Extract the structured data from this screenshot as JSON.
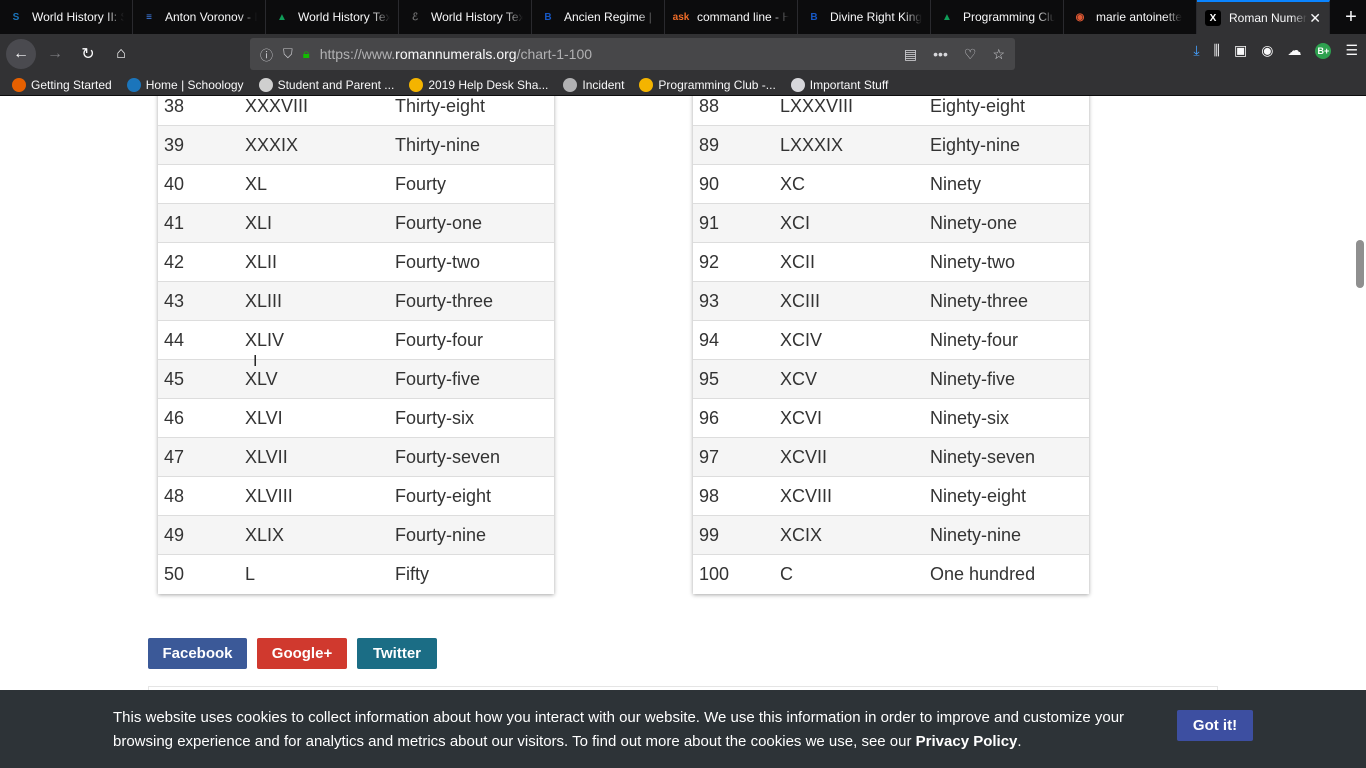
{
  "tabs": [
    {
      "label": "World History II: S",
      "icon": "S",
      "color": "#1b75bb",
      "active": false
    },
    {
      "label": "Anton Voronov - I",
      "icon": "≡",
      "color": "#4285f4",
      "active": false
    },
    {
      "label": "World History Tex",
      "icon": "▲",
      "color": "#0f9d58",
      "active": false
    },
    {
      "label": "World History Tex",
      "icon": "ℰ",
      "color": "#6f6f6f",
      "active": false
    },
    {
      "label": "Ancien Regime | E",
      "icon": "B",
      "color": "#1657c4",
      "active": false
    },
    {
      "label": "command line - H",
      "icon": "ask",
      "color": "#ef6c28",
      "active": false
    },
    {
      "label": "Divine Right King",
      "icon": "B",
      "color": "#1657c4",
      "active": false
    },
    {
      "label": "Programming Clu",
      "icon": "▲",
      "color": "#0f9d58",
      "active": false
    },
    {
      "label": "marie antoinette",
      "icon": "◉",
      "color": "#de5833",
      "active": false
    },
    {
      "label": "Roman Numer",
      "icon": "X",
      "color": "#ffffff",
      "active": true
    }
  ],
  "nav": {
    "url_prefix": "https://www.",
    "url_host": "romannumerals.org",
    "url_path": "/chart-1-100"
  },
  "bookmarks": [
    {
      "label": "Getting Started",
      "icon": "firefox-icon",
      "color": "#e66000"
    },
    {
      "label": "Home | Schoology",
      "icon": "schoology-icon",
      "color": "#1b75bb"
    },
    {
      "label": "Student and Parent ...",
      "icon": "p-icon",
      "color": "#cfcfcf"
    },
    {
      "label": "2019 Help Desk Sha...",
      "icon": "drive-icon",
      "color": "#f4b400"
    },
    {
      "label": "Incident",
      "icon": "globe-icon",
      "color": "#b1b1b3"
    },
    {
      "label": "Programming Club -...",
      "icon": "drive-icon",
      "color": "#f4b400"
    },
    {
      "label": "Important Stuff",
      "icon": "folder-icon",
      "color": "#d7d7db"
    }
  ],
  "left_table": [
    {
      "num": "38",
      "roman": "XXXVIII",
      "word": "Thirty-eight"
    },
    {
      "num": "39",
      "roman": "XXXIX",
      "word": "Thirty-nine"
    },
    {
      "num": "40",
      "roman": "XL",
      "word": "Fourty"
    },
    {
      "num": "41",
      "roman": "XLI",
      "word": "Fourty-one"
    },
    {
      "num": "42",
      "roman": "XLII",
      "word": "Fourty-two"
    },
    {
      "num": "43",
      "roman": "XLIII",
      "word": "Fourty-three"
    },
    {
      "num": "44",
      "roman": "XLIV",
      "word": "Fourty-four"
    },
    {
      "num": "45",
      "roman": "XLV",
      "word": "Fourty-five"
    },
    {
      "num": "46",
      "roman": "XLVI",
      "word": "Fourty-six"
    },
    {
      "num": "47",
      "roman": "XLVII",
      "word": "Fourty-seven"
    },
    {
      "num": "48",
      "roman": "XLVIII",
      "word": "Fourty-eight"
    },
    {
      "num": "49",
      "roman": "XLIX",
      "word": "Fourty-nine"
    },
    {
      "num": "50",
      "roman": "L",
      "word": "Fifty"
    }
  ],
  "right_table": [
    {
      "num": "88",
      "roman": "LXXXVIII",
      "word": "Eighty-eight"
    },
    {
      "num": "89",
      "roman": "LXXXIX",
      "word": "Eighty-nine"
    },
    {
      "num": "90",
      "roman": "XC",
      "word": "Ninety"
    },
    {
      "num": "91",
      "roman": "XCI",
      "word": "Ninety-one"
    },
    {
      "num": "92",
      "roman": "XCII",
      "word": "Ninety-two"
    },
    {
      "num": "93",
      "roman": "XCIII",
      "word": "Ninety-three"
    },
    {
      "num": "94",
      "roman": "XCIV",
      "word": "Ninety-four"
    },
    {
      "num": "95",
      "roman": "XCV",
      "word": "Ninety-five"
    },
    {
      "num": "96",
      "roman": "XCVI",
      "word": "Ninety-six"
    },
    {
      "num": "97",
      "roman": "XCVII",
      "word": "Ninety-seven"
    },
    {
      "num": "98",
      "roman": "XCVIII",
      "word": "Ninety-eight"
    },
    {
      "num": "99",
      "roman": "XCIX",
      "word": "Ninety-nine"
    },
    {
      "num": "100",
      "roman": "C",
      "word": "One hundred"
    }
  ],
  "share": {
    "facebook": "Facebook",
    "google": "Google+",
    "twitter": "Twitter"
  },
  "cookie": {
    "text": "This website uses cookies to collect information about how you interact with our website. We use this information in order to improve and customize your browsing experience and for analytics and metrics about our visitors. To find out more about the cookies we use, see our ",
    "link": "Privacy Policy",
    "end": ".",
    "button": "Got it!"
  },
  "colors": {
    "facebook": "#3b5998",
    "google": "#d0392e",
    "twitter": "#1b6d85",
    "cookie_bg": "#2d3337",
    "got_it": "#3d4fa1",
    "accent": "#0a84ff"
  }
}
